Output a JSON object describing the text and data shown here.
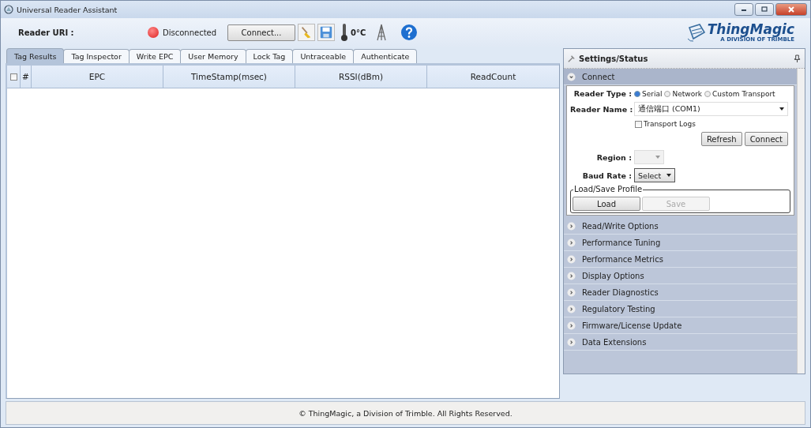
{
  "window": {
    "title": "Universal Reader Assistant"
  },
  "toolbar": {
    "reader_uri_label": "Reader URI :",
    "status": {
      "text": "Disconnected",
      "connected": false
    },
    "connect_button": "Connect...",
    "temperature": "0°C"
  },
  "logo": {
    "name": "ThingMagic",
    "tagline": "A DIVISION OF TRIMBLE"
  },
  "tabs": [
    {
      "label": "Tag Results",
      "selected": true
    },
    {
      "label": "Tag Inspector",
      "selected": false
    },
    {
      "label": "Write EPC",
      "selected": false
    },
    {
      "label": "User Memory",
      "selected": false
    },
    {
      "label": "Lock Tag",
      "selected": false
    },
    {
      "label": "Untraceable",
      "selected": false
    },
    {
      "label": "Authenticate",
      "selected": false
    }
  ],
  "table": {
    "select_all": {
      "checked": false
    },
    "columns": [
      "#",
      "EPC",
      "TimeStamp(msec)",
      "RSSI(dBm)",
      "ReadCount"
    ]
  },
  "settings": {
    "title": "Settings/Status",
    "sections": [
      {
        "title": "Connect",
        "expanded": true
      },
      {
        "title": "Read/Write Options",
        "expanded": false
      },
      {
        "title": "Performance Tuning",
        "expanded": false
      },
      {
        "title": "Performance Metrics",
        "expanded": false
      },
      {
        "title": "Display Options",
        "expanded": false
      },
      {
        "title": "Reader Diagnostics",
        "expanded": false
      },
      {
        "title": "Regulatory Testing",
        "expanded": false
      },
      {
        "title": "Firmware/License Update",
        "expanded": false
      },
      {
        "title": "Data Extensions",
        "expanded": false
      }
    ],
    "connect": {
      "reader_type_label": "Reader Type :",
      "reader_types": [
        {
          "label": "Serial",
          "selected": true
        },
        {
          "label": "Network",
          "selected": false
        },
        {
          "label": "Custom Transport",
          "selected": false
        }
      ],
      "reader_name_label": "Reader Name :",
      "reader_name": "通信端口 (COM1)",
      "transport_logs": {
        "label": "Transport Logs",
        "checked": false
      },
      "buttons": [
        {
          "label": "Refresh",
          "disabled": false
        },
        {
          "label": "Connect",
          "disabled": false
        }
      ],
      "region_label": "Region :",
      "region": {
        "disabled": true
      },
      "baud_rate_label": "Baud Rate :",
      "baud_rate": "Select",
      "profile": {
        "legend": "Load/Save Profile",
        "buttons": [
          {
            "label": "Load",
            "disabled": false
          },
          {
            "label": "Save",
            "disabled": true
          }
        ]
      }
    }
  },
  "footer": "© ThingMagic, a Division of Trimble. All Rights Reserved."
}
